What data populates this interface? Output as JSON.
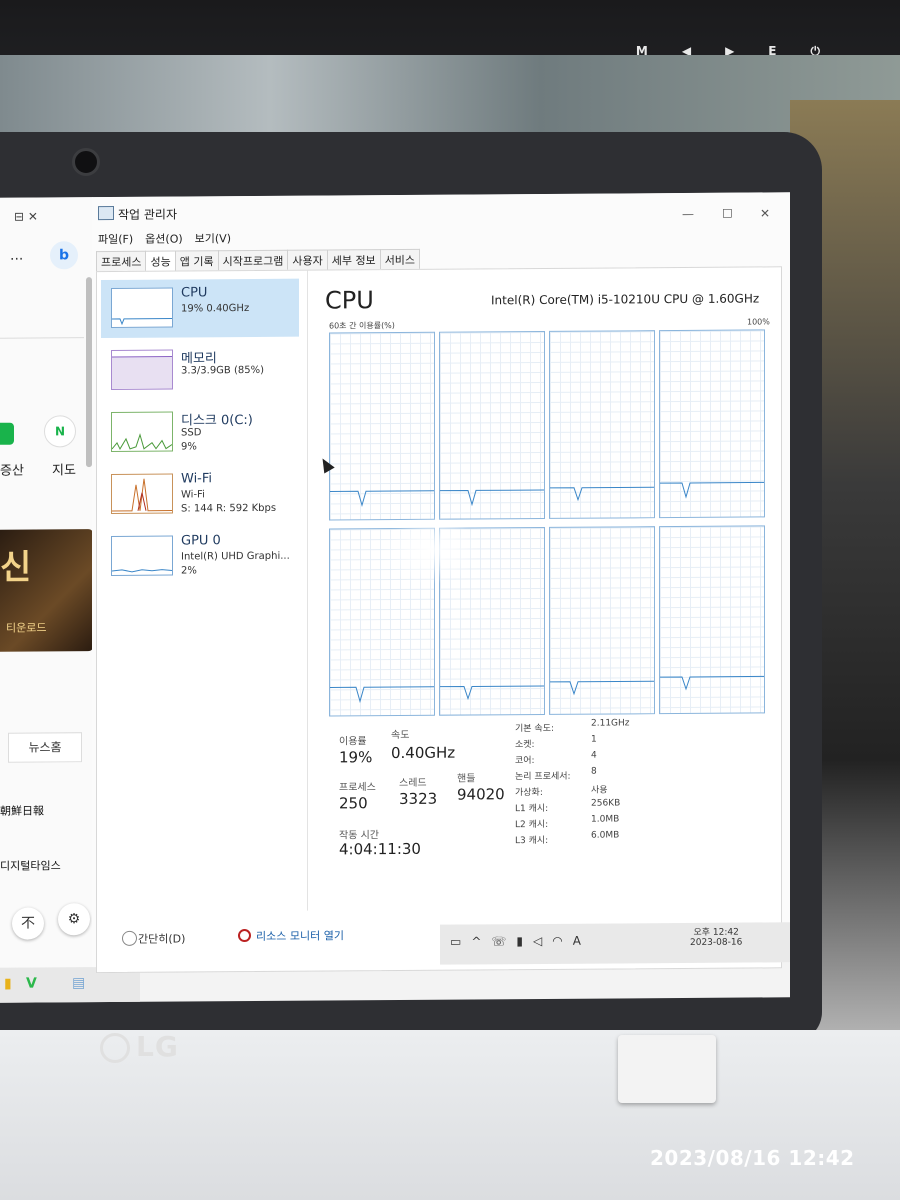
{
  "monitor": {
    "buttons": [
      "M",
      "◀",
      "▶",
      "E",
      "⏻"
    ]
  },
  "laptop": {
    "brand": "LG"
  },
  "photo_timestamp": "2023/08/16   12:42",
  "browser": {
    "tabs_label": "⊟   ✕",
    "menu_dots": "...",
    "nav_label_1": "증산",
    "nav_label_2": "지도",
    "banner_title": "신",
    "banner_sub": "티운로드",
    "news_button": "뉴스홈",
    "news_item_1": "朝鮮日報",
    "news_item_2": "디지털타임스",
    "fab_up": "不",
    "fab_settings": "⚙"
  },
  "taskmanager": {
    "title": "작업 관리자",
    "window_controls": [
      "—",
      "☐",
      "✕"
    ],
    "menu": [
      "파일(F)",
      "옵션(O)",
      "보기(V)"
    ],
    "tabs": [
      "프로세스",
      "성능",
      "앱 기록",
      "시작프로그램",
      "사용자",
      "세부 정보",
      "서비스"
    ],
    "active_tab": 1,
    "sidebar": [
      {
        "name": "CPU",
        "sub1": "19% 0.40GHz",
        "sub2": ""
      },
      {
        "name": "메모리",
        "sub1": "3.3/3.9GB (85%)",
        "sub2": ""
      },
      {
        "name": "디스크 0(C:)",
        "sub1": "SSD",
        "sub2": "9%"
      },
      {
        "name": "Wi-Fi",
        "sub1": "Wi-Fi",
        "sub2": "S: 144  R: 592 Kbps"
      },
      {
        "name": "GPU 0",
        "sub1": "Intel(R) UHD Graphi...",
        "sub2": "2%"
      }
    ],
    "main": {
      "title": "CPU",
      "model": "Intel(R) Core(TM) i5-10210U CPU @ 1.60GHz",
      "graph_label": "60초 간 이용률(%)",
      "graph_max": "100%",
      "stats": {
        "usage_label": "이용률",
        "usage_value": "19%",
        "speed_label": "속도",
        "speed_value": "0.40GHz",
        "processes_label": "프로세스",
        "processes_value": "250",
        "threads_label": "스레드",
        "threads_value": "3323",
        "handles_label": "핸들",
        "handles_value": "94020",
        "uptime_label": "작동 시간",
        "uptime_value": "4:04:11:30"
      },
      "specs": [
        {
          "k": "기본 속도:",
          "v": "2.11GHz"
        },
        {
          "k": "소켓:",
          "v": "1"
        },
        {
          "k": "코어:",
          "v": "4"
        },
        {
          "k": "논리 프로세서:",
          "v": "8"
        },
        {
          "k": "가상화:",
          "v": "사용"
        },
        {
          "k": "L1 캐시:",
          "v": "256KB"
        },
        {
          "k": "L2 캐시:",
          "v": "1.0MB"
        },
        {
          "k": "L3 캐시:",
          "v": "6.0MB"
        }
      ]
    },
    "bottom": {
      "fewer_details": "간단히(D)",
      "resource_monitor": "리소스 모니터 열기"
    }
  },
  "taskbar": {
    "time": "오후 12:42",
    "date": "2023-08-16",
    "lang": "A"
  }
}
